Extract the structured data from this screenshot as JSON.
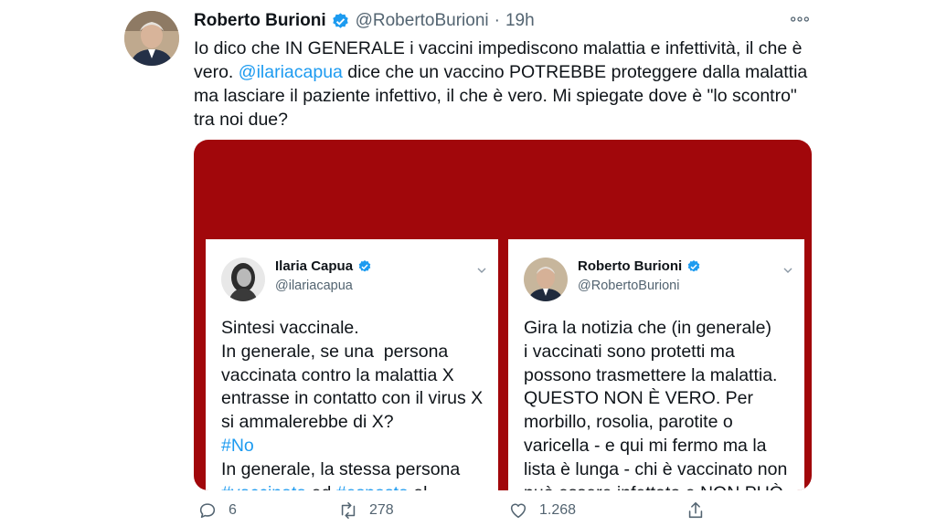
{
  "author": {
    "name": "Roberto Burioni",
    "handle": "@RobertoBurioni",
    "separator": "·",
    "time": "19h"
  },
  "tweet": {
    "text_1": "Io dico che IN GENERALE i vaccini impediscono malattia e infettività, il che è vero. ",
    "mention": "@ilariacapua",
    "text_2": " dice che un vaccino POTREBBE proteggere dalla malattia ma lasciare il paziente infettivo, il che è vero. Mi spiegate dove è \"lo scontro\" tra noi due?"
  },
  "embedded_left": {
    "name": "Ilaria Capua",
    "handle": "@ilariacapua",
    "lines_1": "Sintesi vaccinale.\nIn generale, se una  persona\nvaccinata contro la malattia X\nentrasse in contatto con il virus X\nsi ammalerebbe di X?\n",
    "hashtag_no": "#No",
    "line_2": "\nIn generale, la stessa persona\n",
    "hashtag_vacc": "#vaccinata",
    "word_ed": " ed ",
    "hashtag_esp": "#esposta",
    "word_al": " al"
  },
  "embedded_right": {
    "name": "Roberto Burioni",
    "handle": "@RobertoBurioni",
    "text": "Gira la notizia che (in generale)\ni vaccinati sono protetti ma\npossono trasmettere la malattia.\nQUESTO NON È VERO. Per\nmorbillo, rosolia, parotite o\nvaricella - e qui mi fermo ma la\nlista è lunga - chi è vaccinato non\npuò essere infettato e NON PUÒ"
  },
  "actions": {
    "reply_count": "6",
    "retweet_count": "278",
    "like_count": "1.268"
  },
  "icons": {
    "verified": "verified-badge-icon",
    "more": "more-options-icon",
    "chevron": "chevron-down-icon",
    "reply": "reply-icon",
    "retweet": "retweet-icon",
    "like": "heart-icon",
    "share": "share-icon"
  },
  "colors": {
    "accent": "#1d9bf0",
    "media_background": "#a1070b",
    "secondary_text": "#536471"
  }
}
